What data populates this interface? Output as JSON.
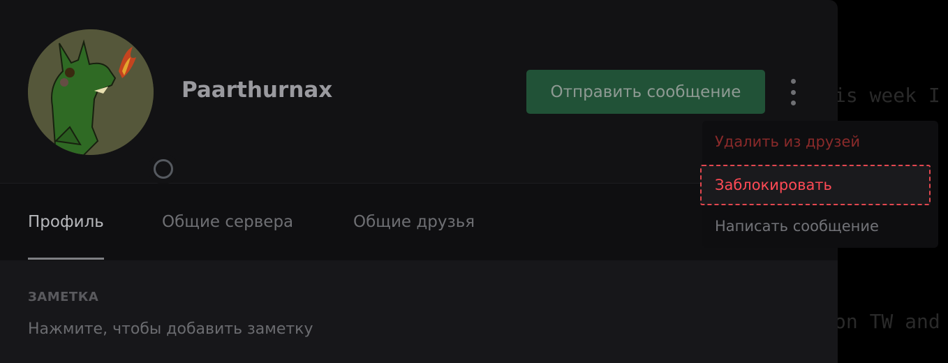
{
  "background": {
    "line1": "is week I",
    "line2": "on TW and"
  },
  "profile": {
    "username": "Paarthurnax",
    "status": "offline",
    "send_message_label": "Отправить сообщение",
    "more_icon": "more-vertical-icon"
  },
  "tabs": [
    {
      "label": "Профиль",
      "active": true
    },
    {
      "label": "Общие сервера",
      "active": false
    },
    {
      "label": "Общие друзья",
      "active": false
    }
  ],
  "note": {
    "title": "ЗАМЕТКА",
    "placeholder": "Нажмите, чтобы добавить заметку"
  },
  "menu": {
    "items": [
      {
        "label": "Удалить из друзей",
        "color": "#8a2a2a"
      },
      {
        "label": "Заблокировать",
        "color": "#ff4a55",
        "highlighted": true
      },
      {
        "label": "Написать сообщение",
        "color": "#727378"
      }
    ]
  },
  "colors": {
    "accent_green": "#215237",
    "danger": "#ff4a55"
  }
}
